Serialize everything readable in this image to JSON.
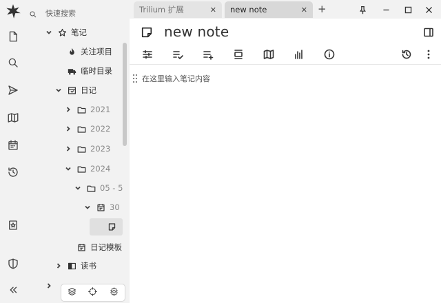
{
  "search": {
    "placeholder": "快速搜索"
  },
  "tree": {
    "root": "笔记",
    "items": {
      "watch": "关注项目",
      "temp": "临时目录",
      "diary": "日记",
      "y2021": "2021",
      "y2022": "2022",
      "y2023": "2023",
      "y2024": "2024",
      "month": "05 - 5",
      "day": "30",
      "diary_template": "日记模板",
      "reading": "读书"
    }
  },
  "tabs": [
    {
      "label": "Trilium 扩展",
      "active": false
    },
    {
      "label": "new note",
      "active": true
    }
  ],
  "note": {
    "title": "new note",
    "editor_placeholder": "在这里输入笔记内容"
  },
  "colors": {
    "sidebar_bg": "#f2f2f2",
    "active_tab_bg": "#d8d8d8",
    "selected_node_bg": "#e0e0e0"
  },
  "icons": {
    "launcher": [
      "trilium-logo-icon",
      "new-note-icon",
      "search-icon",
      "jump-to-icon",
      "note-map-icon",
      "calendar-icon",
      "recent-changes-icon",
      "bookmark-icon",
      "protected-session-icon",
      "collapse-icon"
    ],
    "ribbon": [
      "properties-icon",
      "checklist-icon",
      "add-list-icon",
      "align-icon",
      "map-icon",
      "chart-icon",
      "info-icon",
      "history-icon",
      "more-icon"
    ]
  }
}
